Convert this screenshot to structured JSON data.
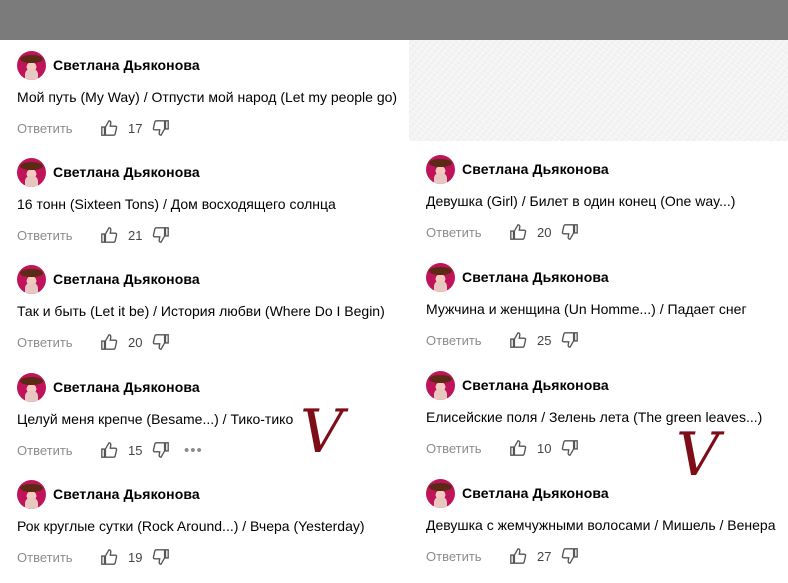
{
  "comments": [
    {
      "author": "Светлана Дьяконова",
      "text": "Мой путь (My Way) / Отпусти мой народ (Let my people go)",
      "reply": "Ответить",
      "likes": "17"
    },
    {
      "author": "Светлана Дьяконова",
      "text": "16 тонн (Sixteen Tons) / Дом восходящего солнца",
      "reply": "Ответить",
      "likes": "21"
    },
    {
      "author": "Светлана Дьяконова",
      "text": "Так и быть (Let it be) / История любви (Where Do I Begin)",
      "reply": "Ответить",
      "likes": "20"
    },
    {
      "author": "Светлана Дьяконова",
      "text": "Целуй меня крепче (Besame...) / Тико-тико",
      "reply": "Ответить",
      "likes": "15",
      "more": "•••"
    },
    {
      "author": "Светлана Дьяконова",
      "text": "Рок круглые сутки (Rock Around...) / Вчера (Yesterday)",
      "reply": "Ответить",
      "likes": "19"
    },
    {
      "author": "Светлана Дьяконова",
      "text": "Девушка (Girl) / Билет в один конец (One way...)",
      "reply": "Ответить",
      "likes": "20"
    },
    {
      "author": "Светлана Дьяконова",
      "text": "Мужчина и женщина (Un Homme...) / Падает снег",
      "reply": "Ответить",
      "likes": "25"
    },
    {
      "author": "Светлана Дьяконова",
      "text": "Елисейские поля / Зелень лета (The green leaves...)",
      "reply": "Ответить",
      "likes": "10"
    },
    {
      "author": "Светлана Дьяконова",
      "text": "Девушка с жемчужными волосами / Мишель / Венера",
      "reply": "Ответить",
      "likes": "27"
    }
  ],
  "marks": {
    "left": "V",
    "right": "V"
  },
  "colors": {
    "topbar": "#7b7b7b",
    "mark": "#7d0d17",
    "avatar": "#c0145a"
  },
  "icons": {
    "like": "thumbs-up-icon",
    "dislike": "thumbs-down-icon"
  }
}
